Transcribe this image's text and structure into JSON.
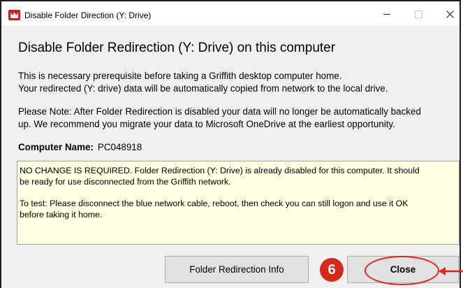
{
  "window": {
    "title": "Disable Folder Direction (Y: Drive)",
    "controls": {
      "minimize": "minimize-icon",
      "maximize": "maximize-icon",
      "close": "close-icon"
    }
  },
  "content": {
    "heading": "Disable Folder Redirection (Y: Drive) on this computer",
    "intro_lines": [
      "This is necessary prerequisite before taking a Griffith desktop computer home.",
      "Your redirected (Y: drive) data will be automatically copied from network to the local drive."
    ],
    "note_lines": [
      "Please Note: After Folder Redirection is disabled your data will no longer be automatically backed",
      "up. We recommend you migrate your data to Microsoft OneDrive at the earliest opportunity."
    ],
    "computer_name": {
      "label": "Computer Name:",
      "value": "PC048918"
    },
    "notice": {
      "paragraph1": [
        "NO CHANGE IS REQUIRED. Folder Redirection (Y: Drive) is already disabled for this computer. It should",
        "be ready for use disconnected from the Griffith network."
      ],
      "paragraph2": [
        "To test: Please disconnect the blue network cable, reboot, then check you can still logon and use it OK",
        "before taking it home."
      ]
    }
  },
  "buttons": {
    "info": "Folder Redirection Info",
    "close": "Close"
  },
  "annotation": {
    "step_number": "6",
    "color": "#e5231b"
  }
}
